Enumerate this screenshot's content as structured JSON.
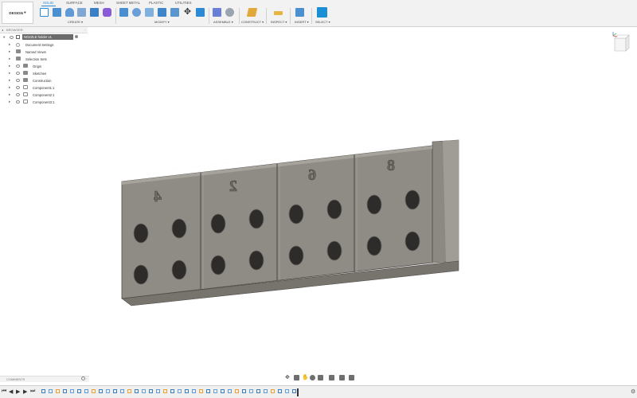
{
  "toolbar": {
    "workspace": "DESIGN",
    "tabs": [
      {
        "label": "SOLID",
        "active": true
      },
      {
        "label": "SURFACE"
      },
      {
        "label": "MESH"
      },
      {
        "label": "SHEET METAL"
      },
      {
        "label": "PLASTIC"
      },
      {
        "label": "UTILITIES"
      }
    ],
    "groups": {
      "create": "CREATE",
      "modify": "MODIFY",
      "assemble": "ASSEMBLE",
      "construct": "CONSTRUCT",
      "inspect": "INSPECT",
      "insert": "INSERT",
      "select": "SELECT"
    }
  },
  "browser": {
    "title": "BROWSER",
    "root": "NOZZLE holder v1",
    "items": [
      {
        "label": "Document Settings",
        "icon": "settings-icon"
      },
      {
        "label": "Named Views",
        "icon": "folder-icon"
      },
      {
        "label": "Selection Sets",
        "icon": "folder-icon"
      },
      {
        "label": "Origin",
        "icon": "folder-icon"
      },
      {
        "label": "Sketches",
        "icon": "folder-icon"
      },
      {
        "label": "Construction",
        "icon": "folder-icon"
      },
      {
        "label": "Component1:1",
        "icon": "component-icon"
      },
      {
        "label": "Component2:1",
        "icon": "component-icon"
      },
      {
        "label": "Component3:1",
        "icon": "component-icon"
      }
    ]
  },
  "model": {
    "labels": [
      "4",
      "2",
      "6",
      "8"
    ]
  },
  "comments": {
    "title": "COMMENTS"
  },
  "colors": {
    "accent": "#2b8ad6",
    "model": "#8e8b84",
    "toolbar": "#f2f2f2"
  }
}
